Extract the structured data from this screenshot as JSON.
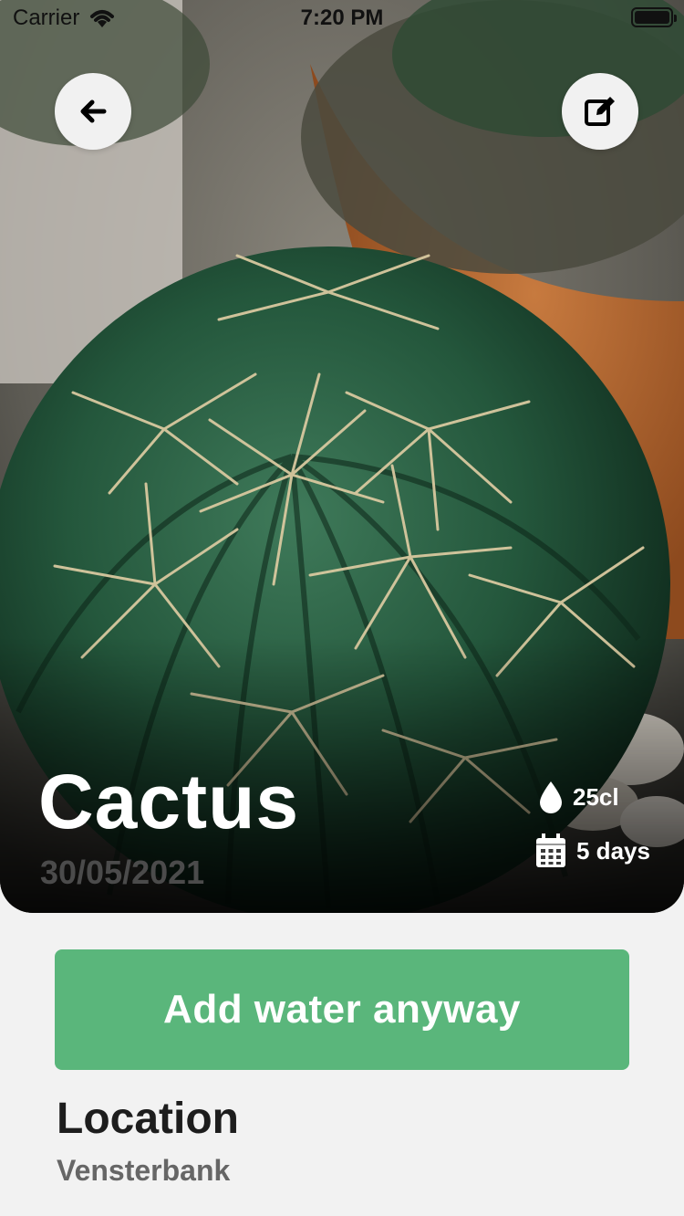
{
  "status_bar": {
    "carrier": "Carrier",
    "time": "7:20 PM"
  },
  "header": {
    "back_icon": "arrow-left-icon",
    "edit_icon": "edit-icon"
  },
  "plant": {
    "name": "Cactus",
    "date": "30/05/2021",
    "water_amount": "25cl",
    "interval": "5 days",
    "water_icon": "water-drop-icon",
    "interval_icon": "calendar-icon"
  },
  "actions": {
    "add_water_label": "Add water anyway"
  },
  "location": {
    "title": "Location",
    "value": "Vensterbank"
  },
  "colors": {
    "accent_green": "#5ab67b",
    "background": "#f2f2f2"
  }
}
